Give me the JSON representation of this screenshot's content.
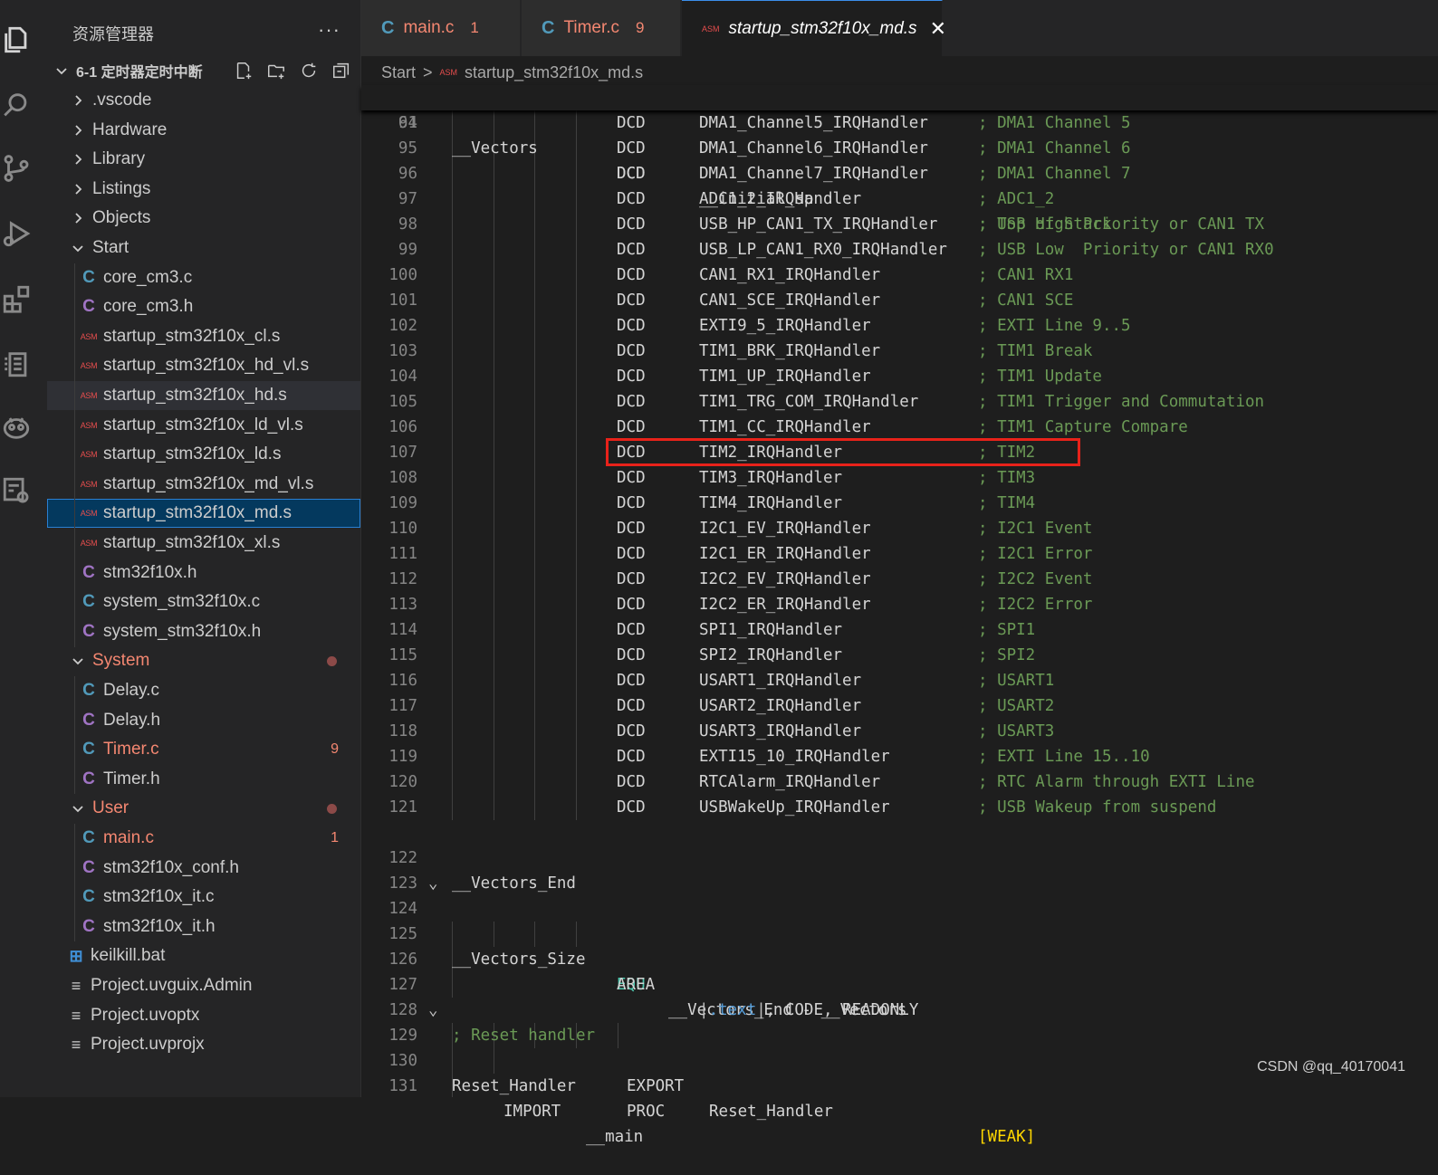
{
  "sidebar": {
    "title": "资源管理器",
    "more": "···",
    "root": "6-1 定时器定时中断",
    "items": [
      {
        "label": ".vscode",
        "type": "folder",
        "expanded": false,
        "depth": 1
      },
      {
        "label": "Hardware",
        "type": "folder",
        "expanded": false,
        "depth": 1
      },
      {
        "label": "Library",
        "type": "folder",
        "expanded": false,
        "depth": 1
      },
      {
        "label": "Listings",
        "type": "folder",
        "expanded": false,
        "depth": 1
      },
      {
        "label": "Objects",
        "type": "folder",
        "expanded": false,
        "depth": 1
      },
      {
        "label": "Start",
        "type": "folder",
        "expanded": true,
        "depth": 1
      },
      {
        "label": "core_cm3.c",
        "type": "c",
        "depth": 2
      },
      {
        "label": "core_cm3.h",
        "type": "h",
        "depth": 2
      },
      {
        "label": "startup_stm32f10x_cl.s",
        "type": "asm",
        "depth": 2
      },
      {
        "label": "startup_stm32f10x_hd_vl.s",
        "type": "asm",
        "depth": 2
      },
      {
        "label": "startup_stm32f10x_hd.s",
        "type": "asm",
        "depth": 2,
        "state": "hover"
      },
      {
        "label": "startup_stm32f10x_ld_vl.s",
        "type": "asm",
        "depth": 2
      },
      {
        "label": "startup_stm32f10x_ld.s",
        "type": "asm",
        "depth": 2
      },
      {
        "label": "startup_stm32f10x_md_vl.s",
        "type": "asm",
        "depth": 2
      },
      {
        "label": "startup_stm32f10x_md.s",
        "type": "asm",
        "depth": 2,
        "state": "selected"
      },
      {
        "label": "startup_stm32f10x_xl.s",
        "type": "asm",
        "depth": 2
      },
      {
        "label": "stm32f10x.h",
        "type": "h",
        "depth": 2
      },
      {
        "label": "system_stm32f10x.c",
        "type": "c",
        "depth": 2
      },
      {
        "label": "system_stm32f10x.h",
        "type": "h",
        "depth": 2
      },
      {
        "label": "System",
        "type": "folder",
        "expanded": true,
        "depth": 1,
        "error": true,
        "dot": true
      },
      {
        "label": "Delay.c",
        "type": "c",
        "depth": 2
      },
      {
        "label": "Delay.h",
        "type": "h",
        "depth": 2
      },
      {
        "label": "Timer.c",
        "type": "c",
        "depth": 2,
        "error": true,
        "badge": "9"
      },
      {
        "label": "Timer.h",
        "type": "h",
        "depth": 2
      },
      {
        "label": "User",
        "type": "folder",
        "expanded": true,
        "depth": 1,
        "error": true,
        "dot": true
      },
      {
        "label": "main.c",
        "type": "c",
        "depth": 2,
        "error": true,
        "badge": "1"
      },
      {
        "label": "stm32f10x_conf.h",
        "type": "h",
        "depth": 2
      },
      {
        "label": "stm32f10x_it.c",
        "type": "c",
        "depth": 2
      },
      {
        "label": "stm32f10x_it.h",
        "type": "h",
        "depth": 2
      },
      {
        "label": "keilkill.bat",
        "type": "bat",
        "depth": 1
      },
      {
        "label": "Project.uvguix.Admin",
        "type": "text",
        "depth": 1
      },
      {
        "label": "Project.uvoptx",
        "type": "text",
        "depth": 1
      },
      {
        "label": "Project.uvprojx",
        "type": "text",
        "depth": 1
      }
    ]
  },
  "tabs": [
    {
      "label": "main.c",
      "icon": "C",
      "count": "1",
      "error": true
    },
    {
      "label": "Timer.c",
      "icon": "C",
      "count": "9",
      "error": true
    },
    {
      "label": "startup_stm32f10x_md.s",
      "icon": "ASM",
      "active": true,
      "close": "✕"
    }
  ],
  "breadcrumb": {
    "folder": "Start",
    "separator": ">",
    "file": "startup_stm32f10x_md.s",
    "icon": "ASM"
  },
  "code": {
    "sticky": {
      "n": "61",
      "label": "__Vectors",
      "op": "DCD",
      "arg": "__initial_sp",
      "comment": "; Top of Stack"
    },
    "vectors": [
      {
        "n": "94",
        "op": "DCD",
        "arg": "DMA1_Channel5_IRQHandler",
        "comment": "; DMA1 Channel 5"
      },
      {
        "n": "95",
        "op": "DCD",
        "arg": "DMA1_Channel6_IRQHandler",
        "comment": "; DMA1 Channel 6"
      },
      {
        "n": "96",
        "op": "DCD",
        "arg": "DMA1_Channel7_IRQHandler",
        "comment": "; DMA1 Channel 7"
      },
      {
        "n": "97",
        "op": "DCD",
        "arg": "ADC1_2_IRQHandler",
        "comment": "; ADC1_2"
      },
      {
        "n": "98",
        "op": "DCD",
        "arg": "USB_HP_CAN1_TX_IRQHandler",
        "comment": "; USB High Priority or CAN1 TX"
      },
      {
        "n": "99",
        "op": "DCD",
        "arg": "USB_LP_CAN1_RX0_IRQHandler",
        "comment": "; USB Low  Priority or CAN1 RX0"
      },
      {
        "n": "100",
        "op": "DCD",
        "arg": "CAN1_RX1_IRQHandler",
        "comment": "; CAN1 RX1"
      },
      {
        "n": "101",
        "op": "DCD",
        "arg": "CAN1_SCE_IRQHandler",
        "comment": "; CAN1 SCE"
      },
      {
        "n": "102",
        "op": "DCD",
        "arg": "EXTI9_5_IRQHandler",
        "comment": "; EXTI Line 9..5"
      },
      {
        "n": "103",
        "op": "DCD",
        "arg": "TIM1_BRK_IRQHandler",
        "comment": "; TIM1 Break"
      },
      {
        "n": "104",
        "op": "DCD",
        "arg": "TIM1_UP_IRQHandler",
        "comment": "; TIM1 Update"
      },
      {
        "n": "105",
        "op": "DCD",
        "arg": "TIM1_TRG_COM_IRQHandler",
        "comment": "; TIM1 Trigger and Commutation"
      },
      {
        "n": "106",
        "op": "DCD",
        "arg": "TIM1_CC_IRQHandler",
        "comment": "; TIM1 Capture Compare"
      },
      {
        "n": "107",
        "op": "DCD",
        "arg": "TIM2_IRQHandler",
        "comment": "; TIM2",
        "highlighted": true
      },
      {
        "n": "108",
        "op": "DCD",
        "arg": "TIM3_IRQHandler",
        "comment": "; TIM3"
      },
      {
        "n": "109",
        "op": "DCD",
        "arg": "TIM4_IRQHandler",
        "comment": "; TIM4"
      },
      {
        "n": "110",
        "op": "DCD",
        "arg": "I2C1_EV_IRQHandler",
        "comment": "; I2C1 Event"
      },
      {
        "n": "111",
        "op": "DCD",
        "arg": "I2C1_ER_IRQHandler",
        "comment": "; I2C1 Error"
      },
      {
        "n": "112",
        "op": "DCD",
        "arg": "I2C2_EV_IRQHandler",
        "comment": "; I2C2 Event"
      },
      {
        "n": "113",
        "op": "DCD",
        "arg": "I2C2_ER_IRQHandler",
        "comment": "; I2C2 Error"
      },
      {
        "n": "114",
        "op": "DCD",
        "arg": "SPI1_IRQHandler",
        "comment": "; SPI1"
      },
      {
        "n": "115",
        "op": "DCD",
        "arg": "SPI2_IRQHandler",
        "comment": "; SPI2"
      },
      {
        "n": "116",
        "op": "DCD",
        "arg": "USART1_IRQHandler",
        "comment": "; USART1"
      },
      {
        "n": "117",
        "op": "DCD",
        "arg": "USART2_IRQHandler",
        "comment": "; USART2"
      },
      {
        "n": "118",
        "op": "DCD",
        "arg": "USART3_IRQHandler",
        "comment": "; USART3"
      },
      {
        "n": "119",
        "op": "DCD",
        "arg": "EXTI15_10_IRQHandler",
        "comment": "; EXTI Line 15..10"
      },
      {
        "n": "120",
        "op": "DCD",
        "arg": "RTCAlarm_IRQHandler",
        "comment": "; RTC Alarm through EXTI Line"
      },
      {
        "n": "121",
        "op": "DCD",
        "arg": "USBWakeUp_IRQHandler",
        "comment": "; USB Wakeup from suspend"
      }
    ],
    "tail": [
      {
        "n": "122",
        "kind": "label",
        "text": "__Vectors_End"
      },
      {
        "n": "123",
        "kind": "blank"
      },
      {
        "n": "124",
        "kind": "equ",
        "fold": true,
        "label": "__Vectors_Size",
        "op": "EQU",
        "expr": "__Vectors_End - __Vectors"
      },
      {
        "n": "125",
        "kind": "blank"
      },
      {
        "n": "126",
        "kind": "area",
        "op": "AREA",
        "name": ".text",
        "rest": ", CODE, READONLY"
      },
      {
        "n": "127",
        "kind": "blank"
      },
      {
        "n": "128",
        "kind": "comment",
        "text": "; Reset handler"
      },
      {
        "n": "129",
        "kind": "proc",
        "fold": true,
        "label": "Reset_Handler",
        "op": "PROC"
      },
      {
        "n": "130",
        "kind": "export",
        "op": "EXPORT",
        "arg": "Reset_Handler",
        "attr": "[WEAK]"
      },
      {
        "n": "131",
        "kind": "import",
        "op": "IMPORT",
        "arg": "__main"
      }
    ]
  },
  "watermark": "CSDN @qq_40170041",
  "colors": {
    "accent": "#007acc",
    "error": "#f48771",
    "comment": "#6a9955",
    "highlight_box": "#e8221a"
  }
}
